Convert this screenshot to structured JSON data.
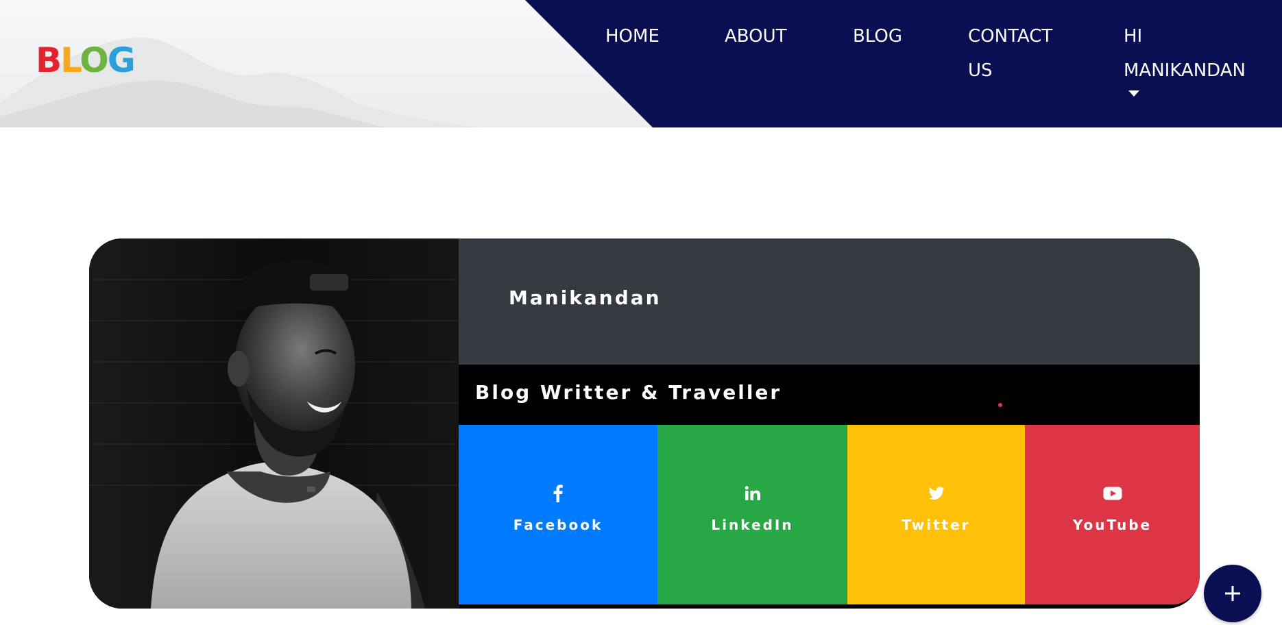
{
  "header": {
    "logo_text": "BLOG",
    "logo_colors": [
      "#e4222e",
      "#f7a81b",
      "#6cb33f",
      "#2b9fd9"
    ],
    "nav_color": "#0a0e52",
    "nav": {
      "home": "HOME",
      "about": "ABOUT",
      "blog": "BLOG",
      "contact_line1": "CONTACT",
      "contact_line2": "US",
      "user_line1": "HI",
      "user_line2": "MANIKANDAN"
    }
  },
  "profile": {
    "name": "Manikandan",
    "role": "Blog Writter & Traveller",
    "photo": "portrait-photo"
  },
  "socials": [
    {
      "label": "Facebook",
      "icon": "facebook-icon",
      "color": "#007bff"
    },
    {
      "label": "LinkedIn",
      "icon": "linkedin-icon",
      "color": "#28a745"
    },
    {
      "label": "Twitter",
      "icon": "twitter-icon",
      "color": "#ffc107"
    },
    {
      "label": "YouTube",
      "icon": "youtube-icon",
      "color": "#dc3545"
    }
  ],
  "fab": {
    "icon": "plus-icon"
  }
}
